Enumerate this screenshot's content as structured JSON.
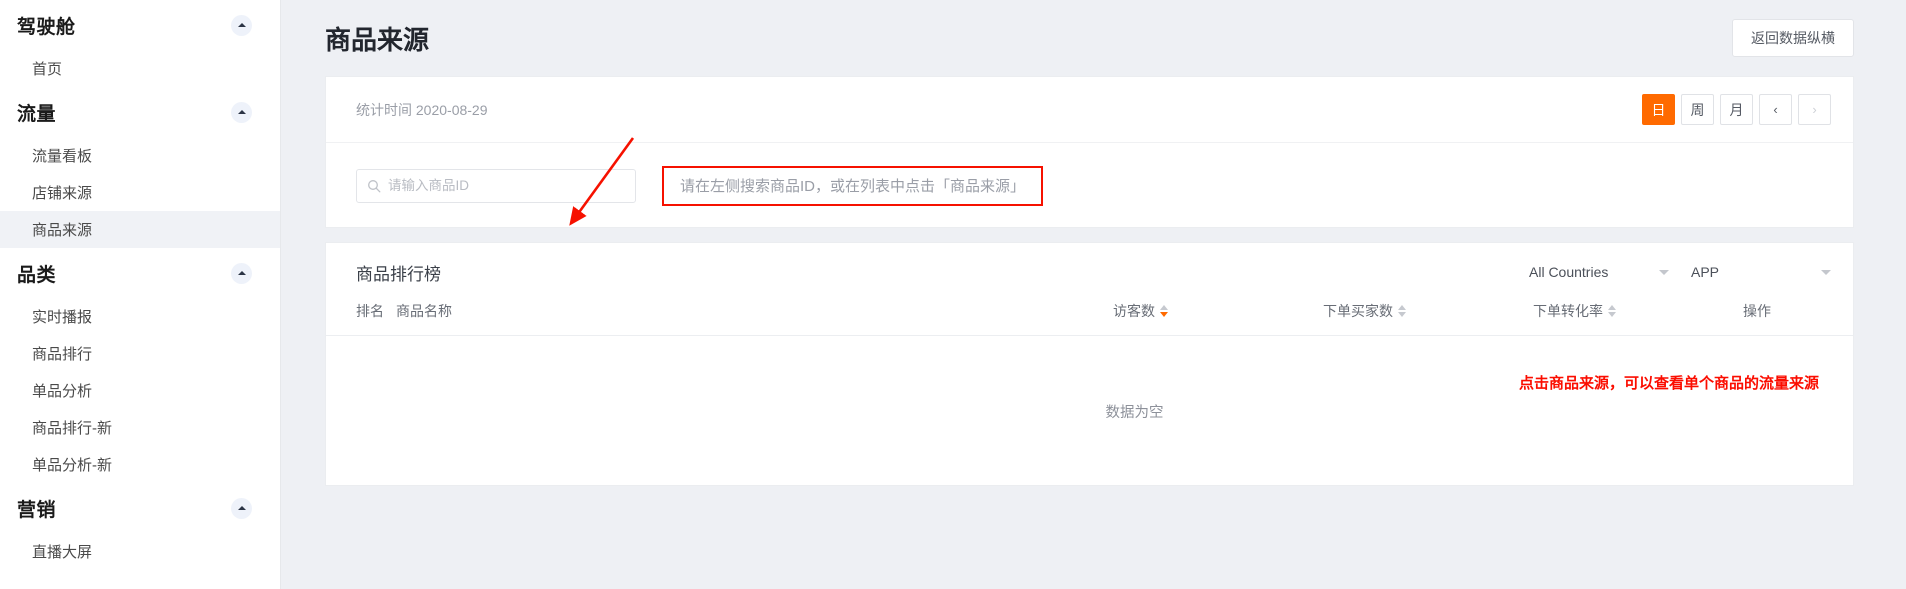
{
  "sidebar": {
    "groups": [
      {
        "label": "驾驶舱",
        "chevron_icon": "chevron-up-icon",
        "items": [
          {
            "label": "首页",
            "active": false
          }
        ]
      },
      {
        "label": "流量",
        "chevron_icon": "chevron-up-icon",
        "items": [
          {
            "label": "流量看板",
            "active": false
          },
          {
            "label": "店铺来源",
            "active": false
          },
          {
            "label": "商品来源",
            "active": true
          }
        ]
      },
      {
        "label": "品类",
        "chevron_icon": "chevron-up-icon",
        "items": [
          {
            "label": "实时播报",
            "active": false
          },
          {
            "label": "商品排行",
            "active": false
          },
          {
            "label": "单品分析",
            "active": false
          },
          {
            "label": "商品排行-新",
            "active": false
          },
          {
            "label": "单品分析-新",
            "active": false
          }
        ]
      },
      {
        "label": "营销",
        "chevron_icon": "chevron-up-icon",
        "items": [
          {
            "label": "直播大屏",
            "active": false
          }
        ]
      }
    ]
  },
  "header": {
    "title": "商品来源",
    "back_button": "返回数据纵横"
  },
  "filter": {
    "stat_time": "统计时间 2020-08-29",
    "range_buttons": [
      {
        "label": "日",
        "active": true,
        "disabled": false
      },
      {
        "label": "周",
        "active": false,
        "disabled": false
      },
      {
        "label": "月",
        "active": false,
        "disabled": false
      },
      {
        "label": "‹",
        "active": false,
        "disabled": false
      },
      {
        "label": "›",
        "active": false,
        "disabled": true
      }
    ],
    "search": {
      "placeholder": "请输入商品ID",
      "value": "",
      "icon": "search-icon"
    },
    "hint": "请在左侧搜索商品ID，或在列表中点击「商品来源」"
  },
  "rank": {
    "title": "商品排行榜",
    "selects": [
      {
        "name": "country",
        "value": "All Countries"
      },
      {
        "name": "platform",
        "value": "APP"
      }
    ],
    "columns": [
      {
        "label": "排名",
        "sortable": false,
        "sort": "none"
      },
      {
        "label": "商品名称",
        "sortable": false,
        "sort": "none"
      },
      {
        "label": "访客数",
        "sortable": true,
        "sort": "desc"
      },
      {
        "label": "下单买家数",
        "sortable": true,
        "sort": "none"
      },
      {
        "label": "下单转化率",
        "sortable": true,
        "sort": "none"
      },
      {
        "label": "操作",
        "sortable": false,
        "sort": "none"
      }
    ],
    "rows": [],
    "empty_text": "数据为空"
  },
  "annotations": {
    "red_note": "点击商品来源，可以查看单个商品的流量来源",
    "arrow_color": "#f61100",
    "box_color": "#f61100"
  },
  "colors": {
    "accent_orange": "#ff6a00",
    "page_bg": "#eef0f4",
    "annotation_red": "#fb0d00"
  }
}
